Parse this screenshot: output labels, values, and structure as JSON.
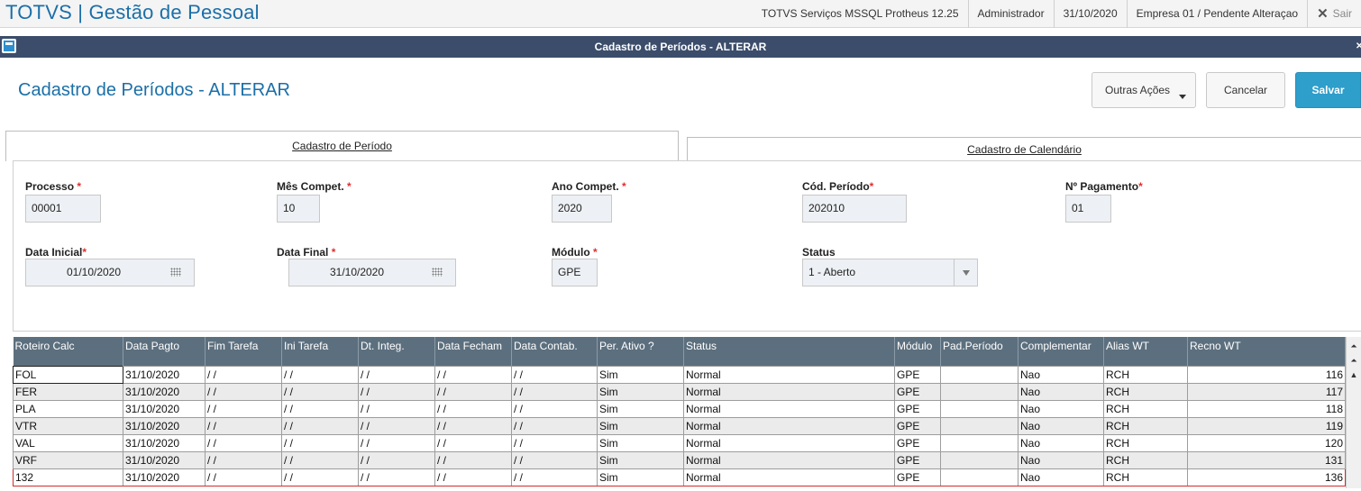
{
  "topbar": {
    "app_title": "TOTVS | Gestão de Pessoal",
    "server": "TOTVS Serviços MSSQL Protheus 12.25",
    "user": "Administrador",
    "date": "31/10/2020",
    "company": "Empresa 01 / Pendente Alteraçao",
    "exit_label": "Sair"
  },
  "window": {
    "title": "Cadastro de Períodos - ALTERAR"
  },
  "header": {
    "title": "Cadastro de Períodos - ALTERAR",
    "outras_acoes": "Outras Ações",
    "cancelar": "Cancelar",
    "salvar": "Salvar"
  },
  "tabs": {
    "periodo": "Cadastro de Período",
    "calendario": "Cadastro de Calendário"
  },
  "form": {
    "processo": {
      "label": "Processo",
      "value": "00001"
    },
    "mes": {
      "label": "Mês Compet.",
      "value": "10"
    },
    "ano": {
      "label": "Ano Compet.",
      "value": "2020"
    },
    "cod": {
      "label": "Cód. Período",
      "value": "202010"
    },
    "npag": {
      "label": "Nº Pagamento",
      "value": "01"
    },
    "dini": {
      "label": "Data Inicial",
      "value": "01/10/2020"
    },
    "dfim": {
      "label": "Data Final",
      "value": "31/10/2020"
    },
    "modulo": {
      "label": "Módulo",
      "value": "GPE"
    },
    "status": {
      "label": "Status",
      "value": "1 - Aberto"
    },
    "required_mark": "*"
  },
  "grid": {
    "columns": [
      "Roteiro Calc",
      "Data Pagto",
      "Fim Tarefa",
      "Ini Tarefa",
      "Dt. Integ.",
      "Data Fecham",
      "Data Contab.",
      "Per. Ativo ?",
      "Status",
      "Módulo",
      "Pad.Período",
      "Complementar",
      "Alias WT",
      "Recno WT"
    ],
    "rows": [
      [
        "FOL",
        "31/10/2020",
        "/ /",
        "/ /",
        "/ /",
        "/ /",
        "/ /",
        "Sim",
        "Normal",
        "GPE",
        "",
        "Nao",
        "RCH",
        "116"
      ],
      [
        "FER",
        "31/10/2020",
        "/ /",
        "/ /",
        "/ /",
        "/ /",
        "/ /",
        "Sim",
        "Normal",
        "GPE",
        "",
        "Nao",
        "RCH",
        "117"
      ],
      [
        "PLA",
        "31/10/2020",
        "/ /",
        "/ /",
        "/ /",
        "/ /",
        "/ /",
        "Sim",
        "Normal",
        "GPE",
        "",
        "Nao",
        "RCH",
        "118"
      ],
      [
        "VTR",
        "31/10/2020",
        "/ /",
        "/ /",
        "/ /",
        "/ /",
        "/ /",
        "Sim",
        "Normal",
        "GPE",
        "",
        "Nao",
        "RCH",
        "119"
      ],
      [
        "VAL",
        "31/10/2020",
        "/ /",
        "/ /",
        "/ /",
        "/ /",
        "/ /",
        "Sim",
        "Normal",
        "GPE",
        "",
        "Nao",
        "RCH",
        "120"
      ],
      [
        "VRF",
        "31/10/2020",
        "/ /",
        "/ /",
        "/ /",
        "/ /",
        "/ /",
        "Sim",
        "Normal",
        "GPE",
        "",
        "Nao",
        "RCH",
        "131"
      ],
      [
        "132",
        "31/10/2020",
        "/ /",
        "/ /",
        "/ /",
        "/ /",
        "/ /",
        "Sim",
        "Normal",
        "GPE",
        "",
        "Nao",
        "RCH",
        "136"
      ]
    ],
    "selected_row": 6
  },
  "colors": {
    "brand": "#1b6fa8",
    "window_bar": "#3c4d6b",
    "primary_button": "#2e9ecb",
    "required": "#e03030",
    "grid_header": "#5c6f7e",
    "selection": "#d02c2c"
  }
}
